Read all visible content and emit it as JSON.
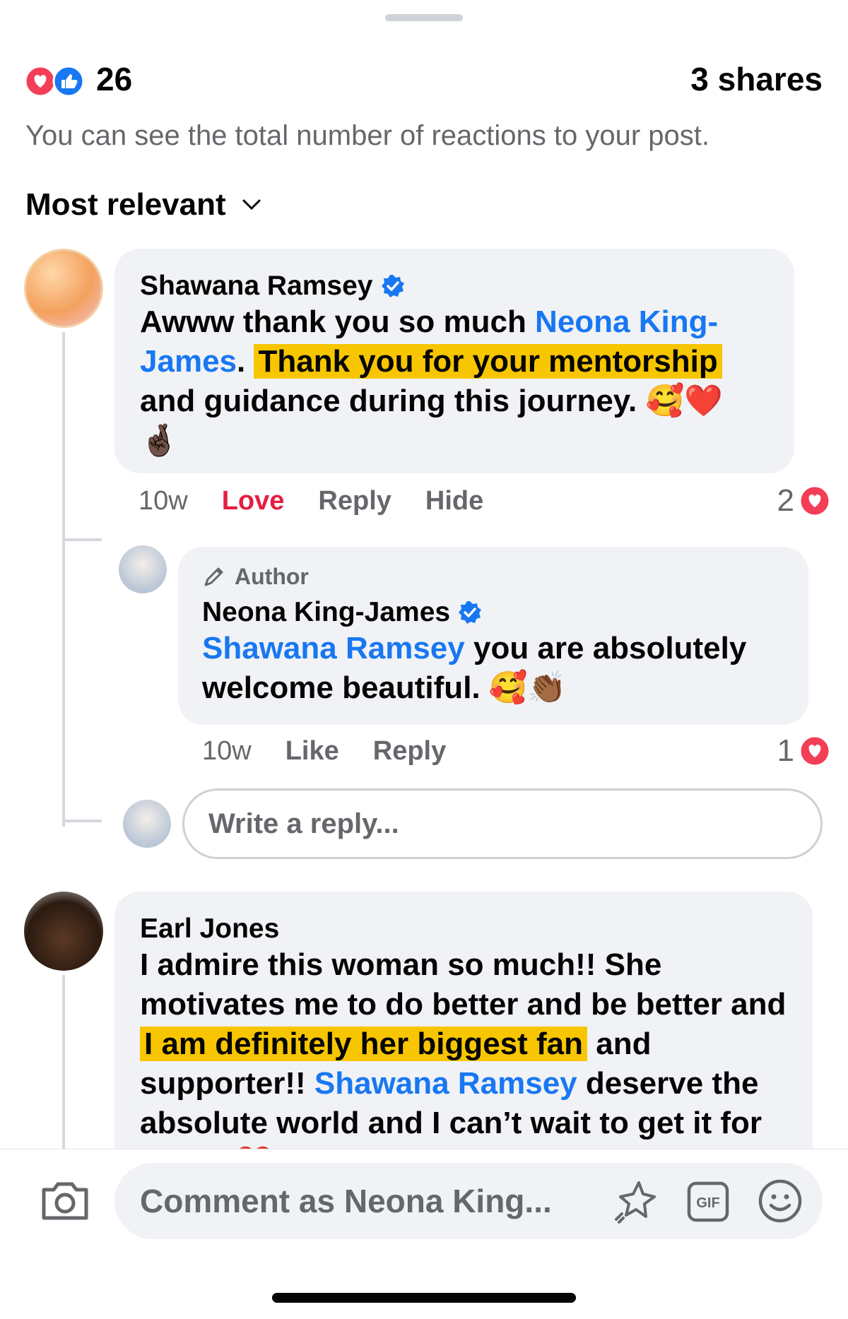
{
  "summary": {
    "reaction_count": "26",
    "shares": "3 shares",
    "hint": "You can see the total number of reactions to your post."
  },
  "sort": {
    "label": "Most relevant"
  },
  "comments": [
    {
      "author": "Shawana Ramsey",
      "verified": true,
      "text_before_mention": "Awww thank you so much ",
      "mention": "Neona King-James",
      "text_after_mention": ". ",
      "highlight": "Thank you for your mentorship",
      "text_end": " and guidance during this journey. ",
      "emoji_tail": "🥰❤️ 🤞🏿",
      "time": "10w",
      "action_reacted": "Love",
      "action_reply": "Reply",
      "action_hide": "Hide",
      "reaction_total": "2"
    },
    {
      "author_tag": "Author",
      "author": "Neona King-James",
      "verified": true,
      "mention": "Shawana Ramsey",
      "text": " you are absolutely welcome beautiful. ",
      "emoji_tail": "🥰👏🏾",
      "time": "10w",
      "action_like": "Like",
      "action_reply": "Reply",
      "reaction_total": "1"
    },
    {
      "author": "Earl Jones",
      "text_start": "I admire this woman so much!! She motivates me to do better and be better and ",
      "highlight": "I am definitely her biggest fan",
      "text_mid": " and supporter!! ",
      "mention": "Shawana Ramsey",
      "text_end": " deserve the absolute world and I can’t wait to get it for you!!! ",
      "emoji_tail": "❤️"
    }
  ],
  "reply_input": {
    "placeholder": "Write a reply..."
  },
  "composer": {
    "placeholder": "Comment as Neona King..."
  },
  "colors": {
    "accent": "#1877f2",
    "love": "#e41e3f",
    "highlight": "#f7c600"
  }
}
